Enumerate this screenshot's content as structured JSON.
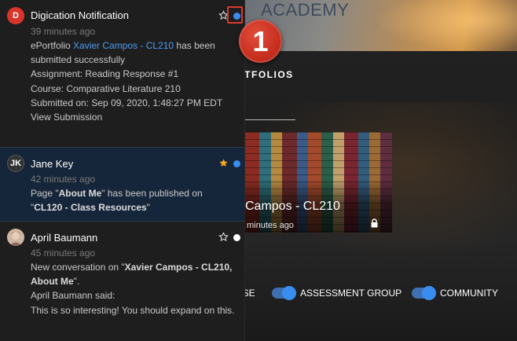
{
  "background": {
    "banner_text": "ACADEMY",
    "section_heading": "RTFOLIOS",
    "portfolio_card": {
      "title": "Campos - CL210",
      "time": "minutes ago"
    },
    "filters": [
      {
        "label": "RSE",
        "state": "on"
      },
      {
        "label": "ASSESSMENT GROUP",
        "state": "on"
      },
      {
        "label": "COMMUNITY",
        "state": "on"
      }
    ]
  },
  "notifications": [
    {
      "avatar_text": "D",
      "avatar_color": "#d9352b",
      "sender": "Digication Notification",
      "time": "39 minutes ago",
      "body": {
        "prefix": "ePortfolio ",
        "link": "Xavier Campos - CL210",
        "line1_suffix": " has been submitted successfully",
        "assignment": "Assignment: Reading Response #1",
        "course": "Course: Comparative Literature 210",
        "submitted": "Submitted on: Sep 09, 2020, 1:48:27 PM EDT",
        "action": "View Submission"
      },
      "starred": false,
      "dot_color": "#3a8df0"
    },
    {
      "avatar_text": "JK",
      "avatar_color": "#333333",
      "sender": "Jane Key",
      "time": "42 minutes ago",
      "body": {
        "p1": "Page \"",
        "b1": "About Me",
        "p2": "\" has been published on \"",
        "b2": "CL120 - Class Resources",
        "p3": "\""
      },
      "starred": true,
      "star_color": "#f5a623",
      "dot_color": "#3a8df0"
    },
    {
      "avatar_text": "",
      "avatar_color": "#b49a8a",
      "sender": "April Baumann",
      "time": "45 minutes ago",
      "body": {
        "p1": "New conversation on \"",
        "b1": "Xavier Campos - CL210, About Me",
        "p2": "\".",
        "said": "April Baumann said:",
        "message": "This is so interesting!  You should expand on this."
      },
      "starred": false,
      "dot_color": "#ffffff"
    }
  ],
  "callout": {
    "number": "1",
    "color": "#d93a2b"
  }
}
